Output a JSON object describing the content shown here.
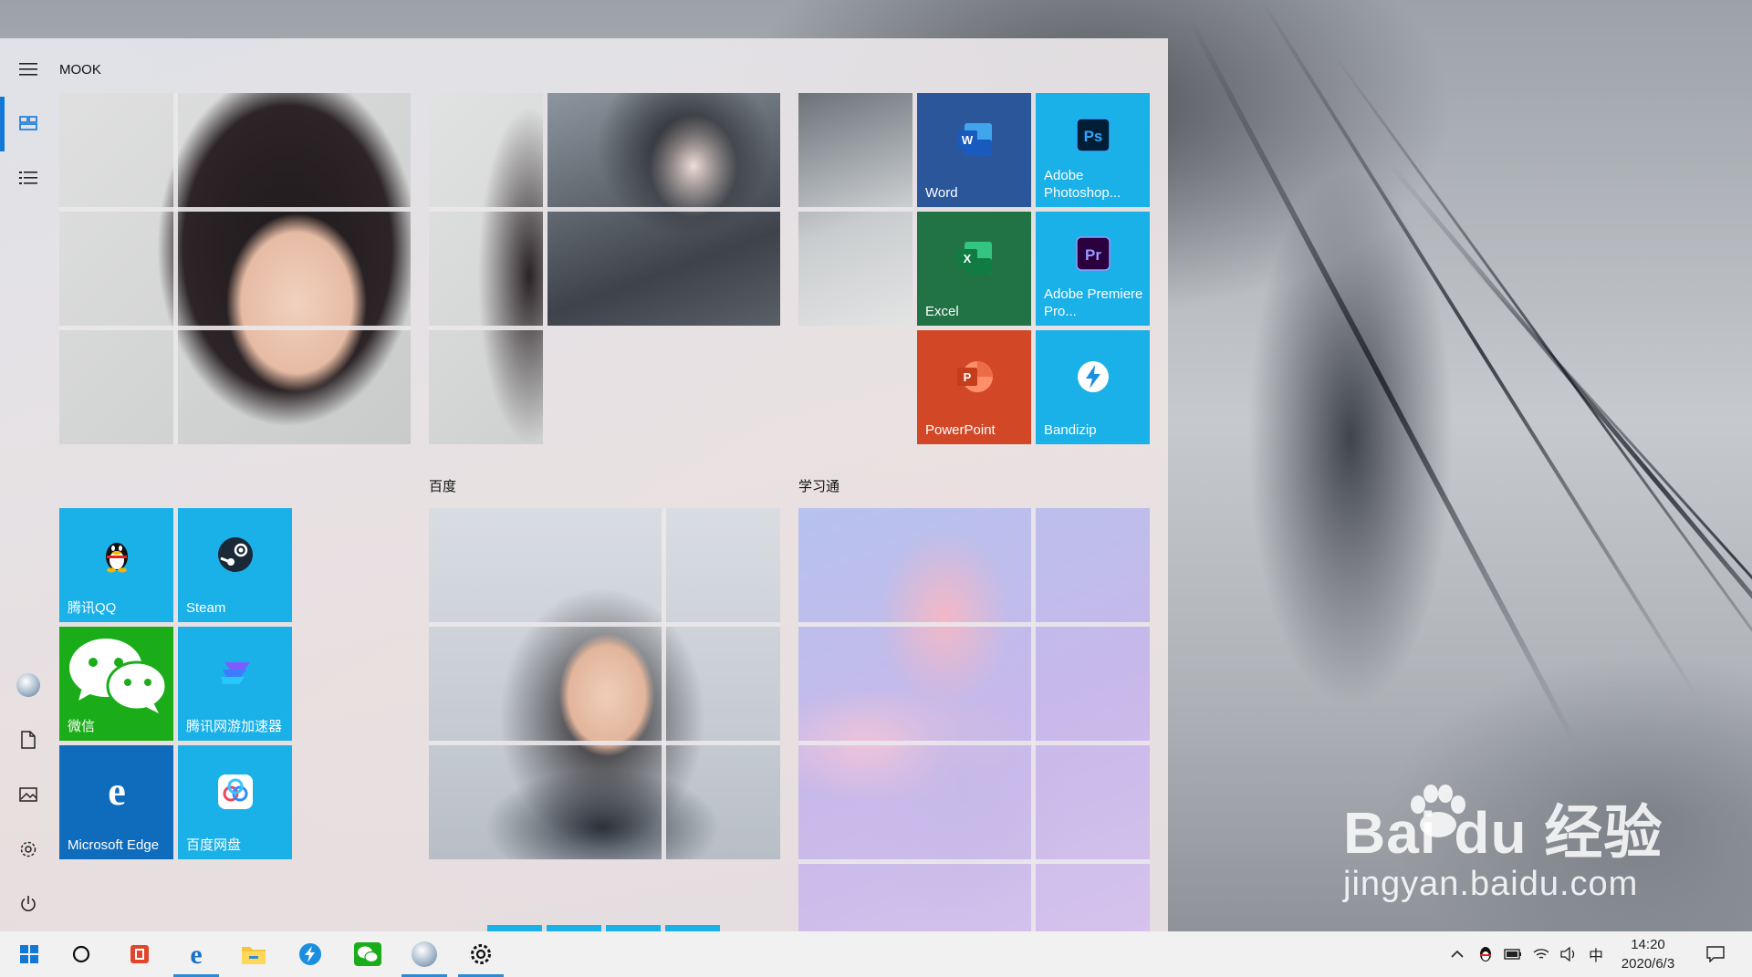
{
  "start_menu": {
    "title": "MOOK",
    "groups": [
      {
        "label": "百度"
      },
      {
        "label": "学习通"
      }
    ],
    "app_tiles": {
      "word": {
        "label": "Word",
        "color": "#2b579a"
      },
      "photoshop": {
        "label": "Adobe Photoshop...",
        "color": "#1ab0e8"
      },
      "excel": {
        "label": "Excel",
        "color": "#217346"
      },
      "premiere": {
        "label": "Adobe Premiere Pro...",
        "color": "#1ab0e8"
      },
      "powerpoint": {
        "label": "PowerPoint",
        "color": "#d24726"
      },
      "bandizip": {
        "label": "Bandizip",
        "color": "#1ab0e8"
      },
      "qq": {
        "label": "腾讯QQ",
        "color": "#1ab0e8"
      },
      "steam": {
        "label": "Steam",
        "color": "#1ab0e8"
      },
      "wechat": {
        "label": "微信",
        "color": "#1aad19"
      },
      "accelerator": {
        "label": "腾讯网游加速器",
        "color": "#1ab0e8"
      },
      "edge": {
        "label": "Microsoft Edge",
        "color": "#0f6cbd"
      },
      "baidu_pan": {
        "label": "百度网盘",
        "color": "#1ab0e8"
      }
    },
    "rail_icons": [
      "hamburger-icon",
      "tiles-icon",
      "list-icon",
      "user-avatar",
      "document-icon",
      "pictures-icon",
      "settings-icon",
      "power-icon"
    ]
  },
  "taskbar": {
    "pinned": [
      "windows-start-icon",
      "cortana-icon",
      "office-icon",
      "edge-icon",
      "file-explorer-icon",
      "bandizip-icon",
      "wechat-icon",
      "avatar-app-icon",
      "settings-icon"
    ],
    "tray": {
      "ime": "中",
      "time": "14:20",
      "date": "2020/6/3"
    }
  },
  "watermark": {
    "brand": "Bai du 经验",
    "url": "jingyan.baidu.com"
  }
}
